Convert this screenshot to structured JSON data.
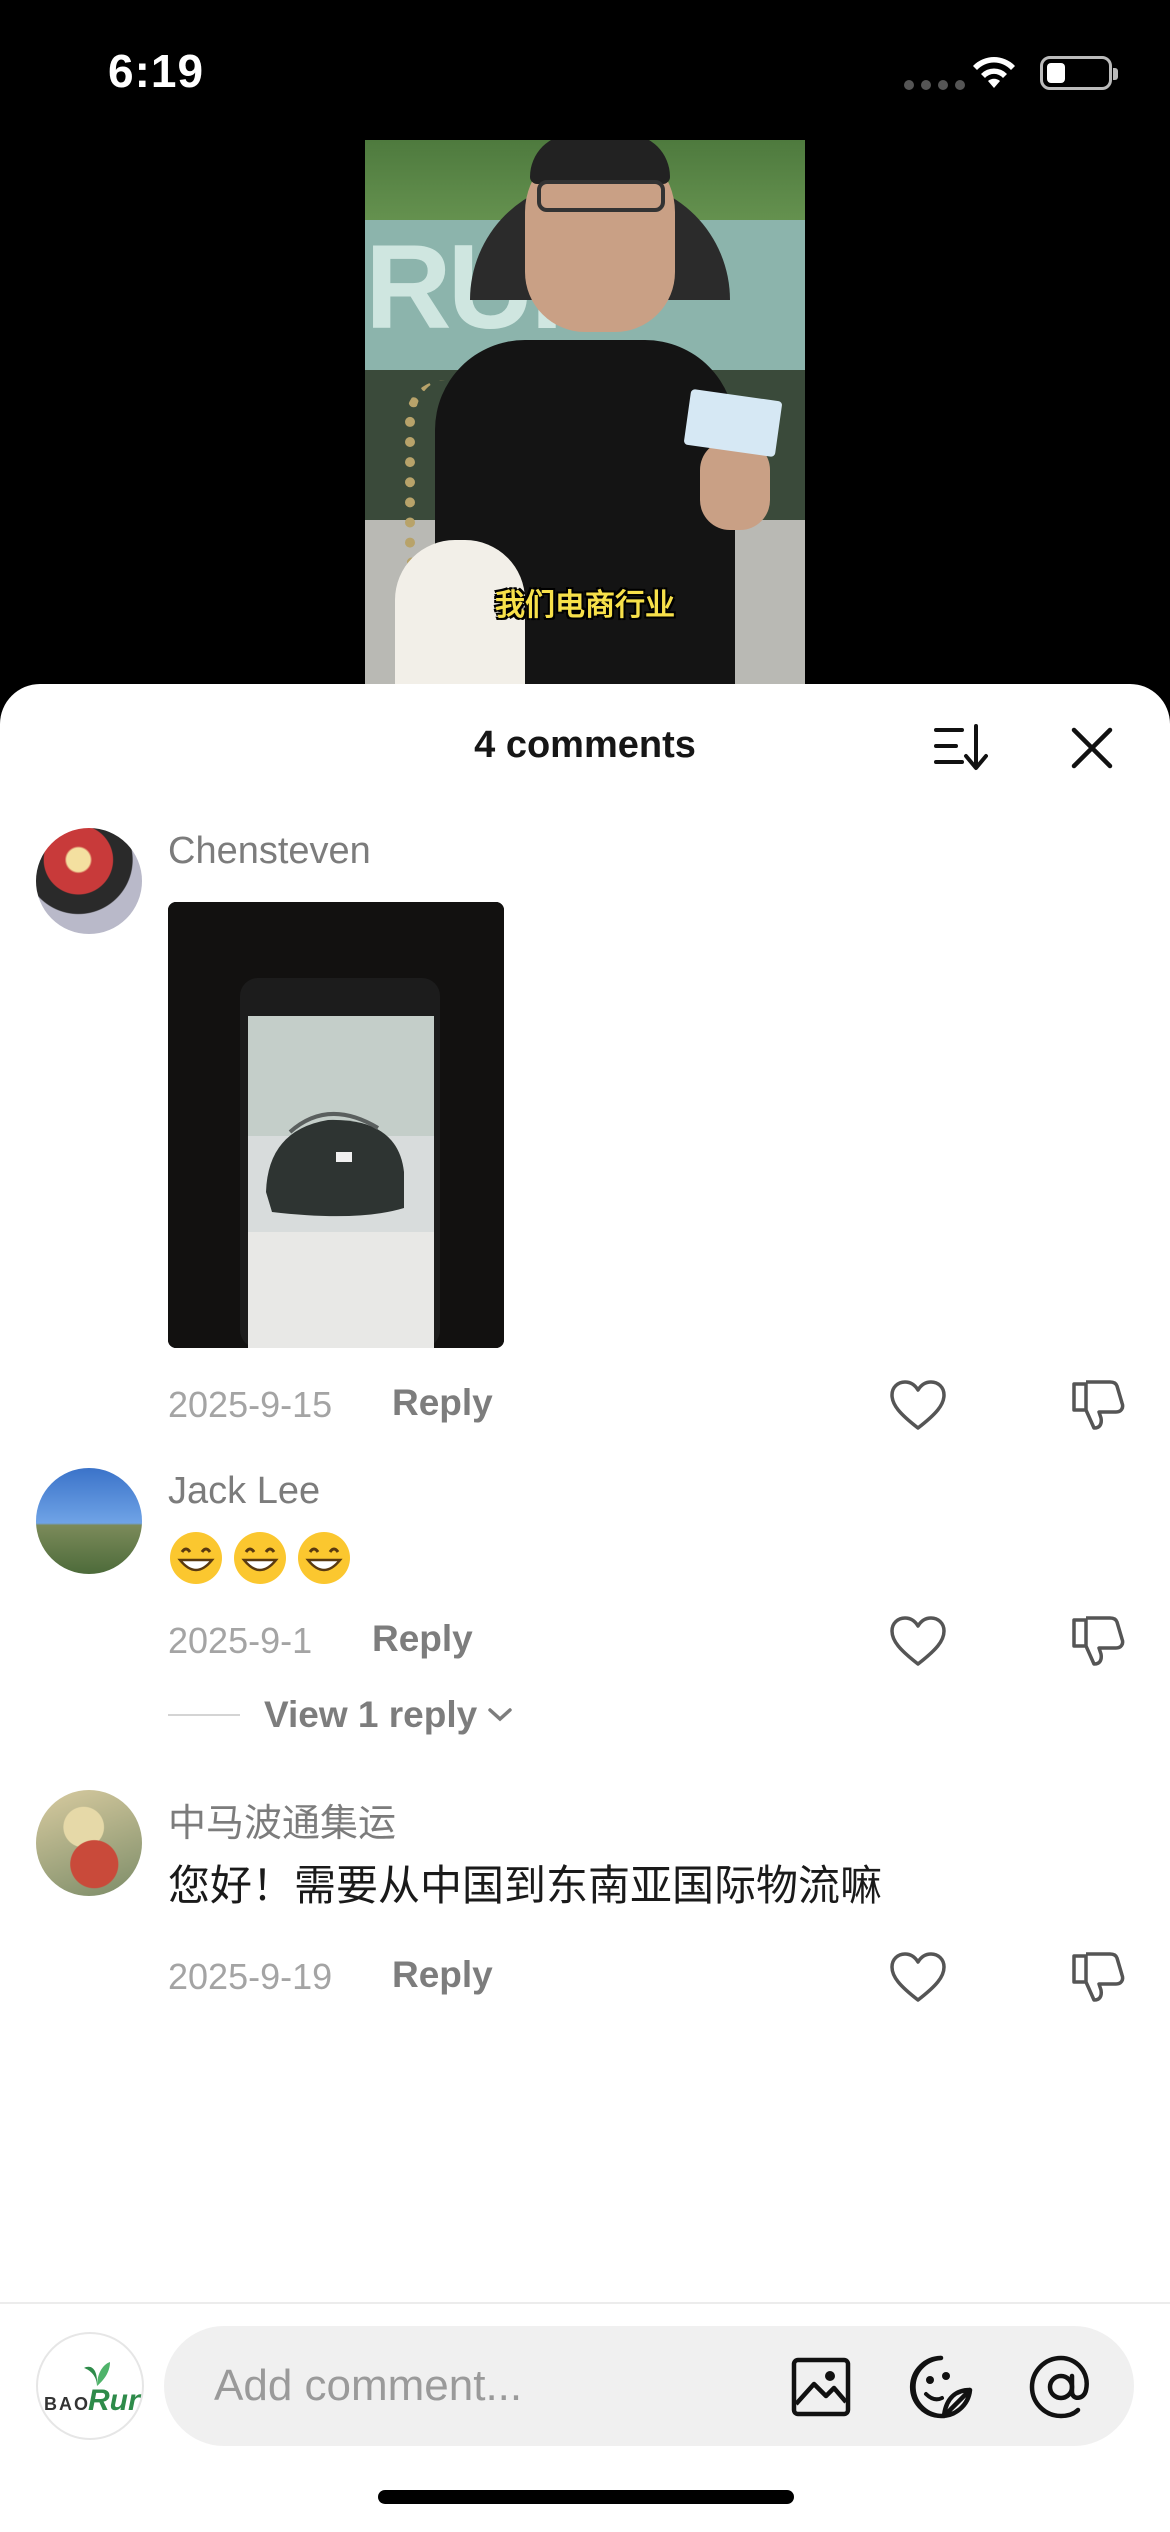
{
  "status_bar": {
    "time": "6:19",
    "icons": [
      "signal-icon",
      "wifi-icon",
      "battery-icon"
    ]
  },
  "video": {
    "caption": "我们电商行业",
    "background_sign_text": "RUI"
  },
  "comments_sheet": {
    "title": "4 comments",
    "sort_icon": "sort-icon",
    "close_icon": "close-icon",
    "comments": [
      {
        "username": "Chensteven",
        "has_image_attachment": true,
        "date": "2025-9-15",
        "reply_label": "Reply"
      },
      {
        "username": "Jack Lee",
        "text": "😄😄😄",
        "date": "2025-9-1",
        "reply_label": "Reply",
        "view_replies": "View 1 reply"
      },
      {
        "username": "中马波通集运",
        "text": "您好！需要从中国到东南亚国际物流嘛",
        "date": "2025-9-19",
        "reply_label": "Reply"
      }
    ]
  },
  "composer": {
    "avatar_logo": {
      "left": "BAO",
      "right": "Run"
    },
    "placeholder": "Add comment...",
    "icons": [
      "image-icon",
      "sticker-icon",
      "mention-icon"
    ]
  },
  "colors": {
    "sheet_background": "#ffffff",
    "text_primary": "#161616",
    "text_secondary": "#7c7c7c",
    "meta": "#a4a4a4",
    "input_background": "#f0f0f0",
    "caption": "#f7e04a"
  }
}
